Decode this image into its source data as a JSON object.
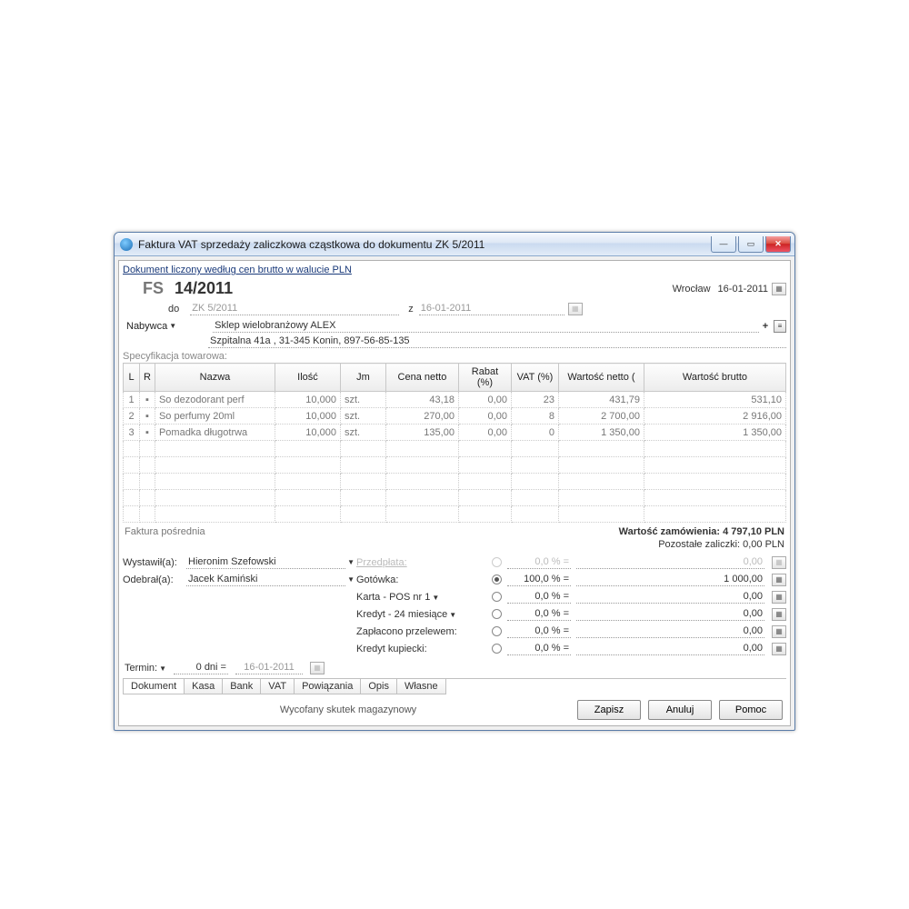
{
  "title": "Faktura VAT sprzedaży zaliczkowa cząstkowa do dokumentu ZK 5/2011",
  "pricing_link": "Dokument liczony według cen brutto w walucie PLN",
  "doc_prefix": "FS",
  "doc_number": "14/2011",
  "city": "Wrocław",
  "doc_date": "16-01-2011",
  "do_label": "do",
  "ref_doc": "ZK 5/2011",
  "z_label": "z",
  "ref_date": "16-01-2011",
  "buyer_label": "Nabywca",
  "buyer_name": "Sklep wielobranżowy  ALEX",
  "buyer_address": "Szpitalna  41a , 31-345 Konin, 897-56-85-135",
  "spec_label": "Specyfikacja towarowa:",
  "cols": {
    "l": "L",
    "r": "R",
    "name": "Nazwa",
    "qty": "Ilość",
    "jm": "Jm",
    "netprice": "Cena netto",
    "rabat": "Rabat (%)",
    "vat": "VAT (%)",
    "netval": "Wartość netto (",
    "grossval": "Wartość brutto"
  },
  "rows": [
    {
      "lp": "1",
      "name": "So dezodorant perf",
      "qty": "10,000",
      "jm": "szt.",
      "np": "43,18",
      "rab": "0,00",
      "vat": "23",
      "nv": "431,79",
      "gv": "531,10"
    },
    {
      "lp": "2",
      "name": "So perfumy 20ml",
      "qty": "10,000",
      "jm": "szt.",
      "np": "270,00",
      "rab": "0,00",
      "vat": "8",
      "nv": "2 700,00",
      "gv": "2 916,00"
    },
    {
      "lp": "3",
      "name": "Pomadka długotrwa",
      "qty": "10,000",
      "jm": "szt.",
      "np": "135,00",
      "rab": "0,00",
      "vat": "0",
      "nv": "1 350,00",
      "gv": "1 350,00"
    }
  ],
  "intermediate": "Faktura pośrednia",
  "order_value": "Wartość zamówienia: 4 797,10 PLN",
  "remaining": "Pozostałe zaliczki: 0,00 PLN",
  "issued_label": "Wystawił(a):",
  "issued_by": "Hieronim Szefowski",
  "received_label": "Odebrał(a):",
  "received_by": "Jacek Kamiński",
  "pay": {
    "prepaid": {
      "label": "Przedpłata:",
      "pct": "0,0 % =",
      "amt": "0,00"
    },
    "cash": {
      "label": "Gotówka:",
      "pct": "100,0 % =",
      "amt": "1 000,00"
    },
    "card": {
      "label": "Karta - POS nr 1",
      "pct": "0,0 % =",
      "amt": "0,00"
    },
    "credit": {
      "label": "Kredyt - 24 miesiące",
      "pct": "0,0 % =",
      "amt": "0,00"
    },
    "transfer": {
      "label": "Zapłacono przelewem:",
      "pct": "0,0 % =",
      "amt": "0,00"
    },
    "trade": {
      "label": "Kredyt kupiecki:",
      "pct": "0,0 % =",
      "amt": "0,00"
    }
  },
  "term_label": "Termin:",
  "term_days": "0 dni =",
  "term_date": "16-01-2011",
  "tabs": [
    "Dokument",
    "Kasa",
    "Bank",
    "VAT",
    "Powiązania",
    "Opis",
    "Własne"
  ],
  "footer_msg": "Wycofany skutek magazynowy",
  "btn_save": "Zapisz",
  "btn_cancel": "Anuluj",
  "btn_help": "Pomoc"
}
